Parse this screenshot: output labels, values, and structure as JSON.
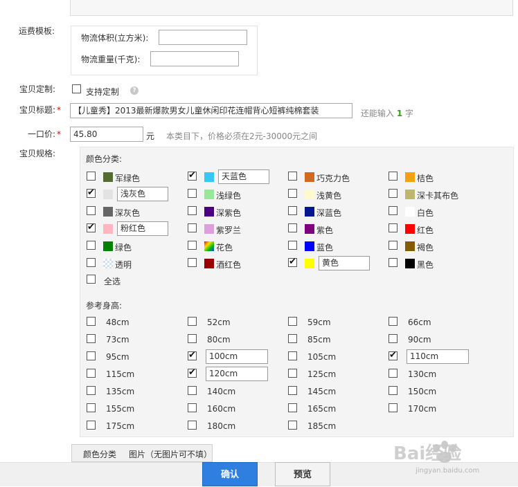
{
  "shipping": {
    "label": "运费模板:",
    "volume_label": "物流体积(立方米):",
    "volume_value": "",
    "weight_label": "物流重量(千克):",
    "weight_value": ""
  },
  "custom": {
    "label": "宝贝定制:",
    "checkbox_label": "支持定制",
    "help": "?"
  },
  "title": {
    "label": "宝贝标题:",
    "star": "*",
    "value": "【儿童秀】2013最新爆款男女儿童休闲印花连帽背心短裤纯棉套装",
    "remain_prefix": "还能输入",
    "remain_count": "1",
    "remain_suffix": "字"
  },
  "price": {
    "label": "一口价:",
    "star": "*",
    "value": "45.80",
    "unit": "元",
    "hint": "本类目下，价格必须在2元-30000元之间"
  },
  "spec": {
    "label": "宝贝规格:",
    "color_title": "颜色分类:",
    "colors": [
      {
        "name": "军绿色",
        "swatch": "#556b2f",
        "checked": false
      },
      {
        "name": "天蓝色",
        "swatch": "#36c9ef",
        "checked": true
      },
      {
        "name": "巧克力色",
        "swatch": "#d2691e",
        "checked": false
      },
      {
        "name": "桔色",
        "swatch": "#f5a00f",
        "checked": false
      },
      {
        "name": "浅灰色",
        "swatch": "#e3e3e3",
        "checked": true
      },
      {
        "name": "浅绿色",
        "swatch": "#98e89a",
        "checked": false
      },
      {
        "name": "浅黄色",
        "swatch": "#fffacd",
        "checked": false
      },
      {
        "name": "深卡其布色",
        "swatch": "#bdb76b",
        "checked": false
      },
      {
        "name": "深灰色",
        "swatch": "#666666",
        "checked": false
      },
      {
        "name": "深紫色",
        "swatch": "#4b0082",
        "checked": false
      },
      {
        "name": "深蓝色",
        "swatch": "#041690",
        "checked": false
      },
      {
        "name": "白色",
        "swatch": "#ffffff",
        "checked": false
      },
      {
        "name": "粉红色",
        "swatch": "#ffb6c1",
        "checked": true
      },
      {
        "name": "紫罗兰",
        "swatch": "#dda0dd",
        "checked": false
      },
      {
        "name": "紫色",
        "swatch": "#800080",
        "checked": false
      },
      {
        "name": "红色",
        "swatch": "#ff0000",
        "checked": false
      },
      {
        "name": "绿色",
        "swatch": "#008000",
        "checked": false
      },
      {
        "name": "花色",
        "swatch": "multicolor",
        "checked": false
      },
      {
        "name": "蓝色",
        "swatch": "#0000ff",
        "checked": false
      },
      {
        "name": "褐色",
        "swatch": "#855b00",
        "checked": false
      },
      {
        "name": "透明",
        "swatch": "transparent",
        "checked": false
      },
      {
        "name": "酒红色",
        "swatch": "#990000",
        "checked": false
      },
      {
        "name": "黄色",
        "swatch": "#ffff00",
        "checked": true
      },
      {
        "name": "黑色",
        "swatch": "#000000",
        "checked": false
      }
    ],
    "select_all": "全选",
    "size_title": "参考身高:",
    "sizes": [
      {
        "name": "48cm",
        "checked": false
      },
      {
        "name": "52cm",
        "checked": false
      },
      {
        "name": "59cm",
        "checked": false
      },
      {
        "name": "66cm",
        "checked": false
      },
      {
        "name": "73cm",
        "checked": false
      },
      {
        "name": "80cm",
        "checked": false
      },
      {
        "name": "85cm",
        "checked": false
      },
      {
        "name": "90cm",
        "checked": false
      },
      {
        "name": "95cm",
        "checked": false
      },
      {
        "name": "100cm",
        "checked": true
      },
      {
        "name": "105cm",
        "checked": false
      },
      {
        "name": "110cm",
        "checked": true
      },
      {
        "name": "115cm",
        "checked": false
      },
      {
        "name": "120cm",
        "checked": true
      },
      {
        "name": "125cm",
        "checked": false
      },
      {
        "name": "130cm",
        "checked": false
      },
      {
        "name": "135cm",
        "checked": false
      },
      {
        "name": "140cm",
        "checked": false
      },
      {
        "name": "145cm",
        "checked": false
      },
      {
        "name": "150cm",
        "checked": false
      },
      {
        "name": "155cm",
        "checked": false
      },
      {
        "name": "160cm",
        "checked": false
      },
      {
        "name": "165cm",
        "checked": false
      },
      {
        "name": "170cm",
        "checked": false
      },
      {
        "name": "175cm",
        "checked": false
      },
      {
        "name": "180cm",
        "checked": false
      },
      {
        "name": "185cm",
        "checked": false
      }
    ]
  },
  "tabs": {
    "color": "颜色分类",
    "image": "图片（无图片可不填）"
  },
  "buttons": {
    "confirm": "确认",
    "preview": "预览"
  },
  "watermark": {
    "brand": "Bai经验",
    "url": "jingyan.baidu.com"
  }
}
